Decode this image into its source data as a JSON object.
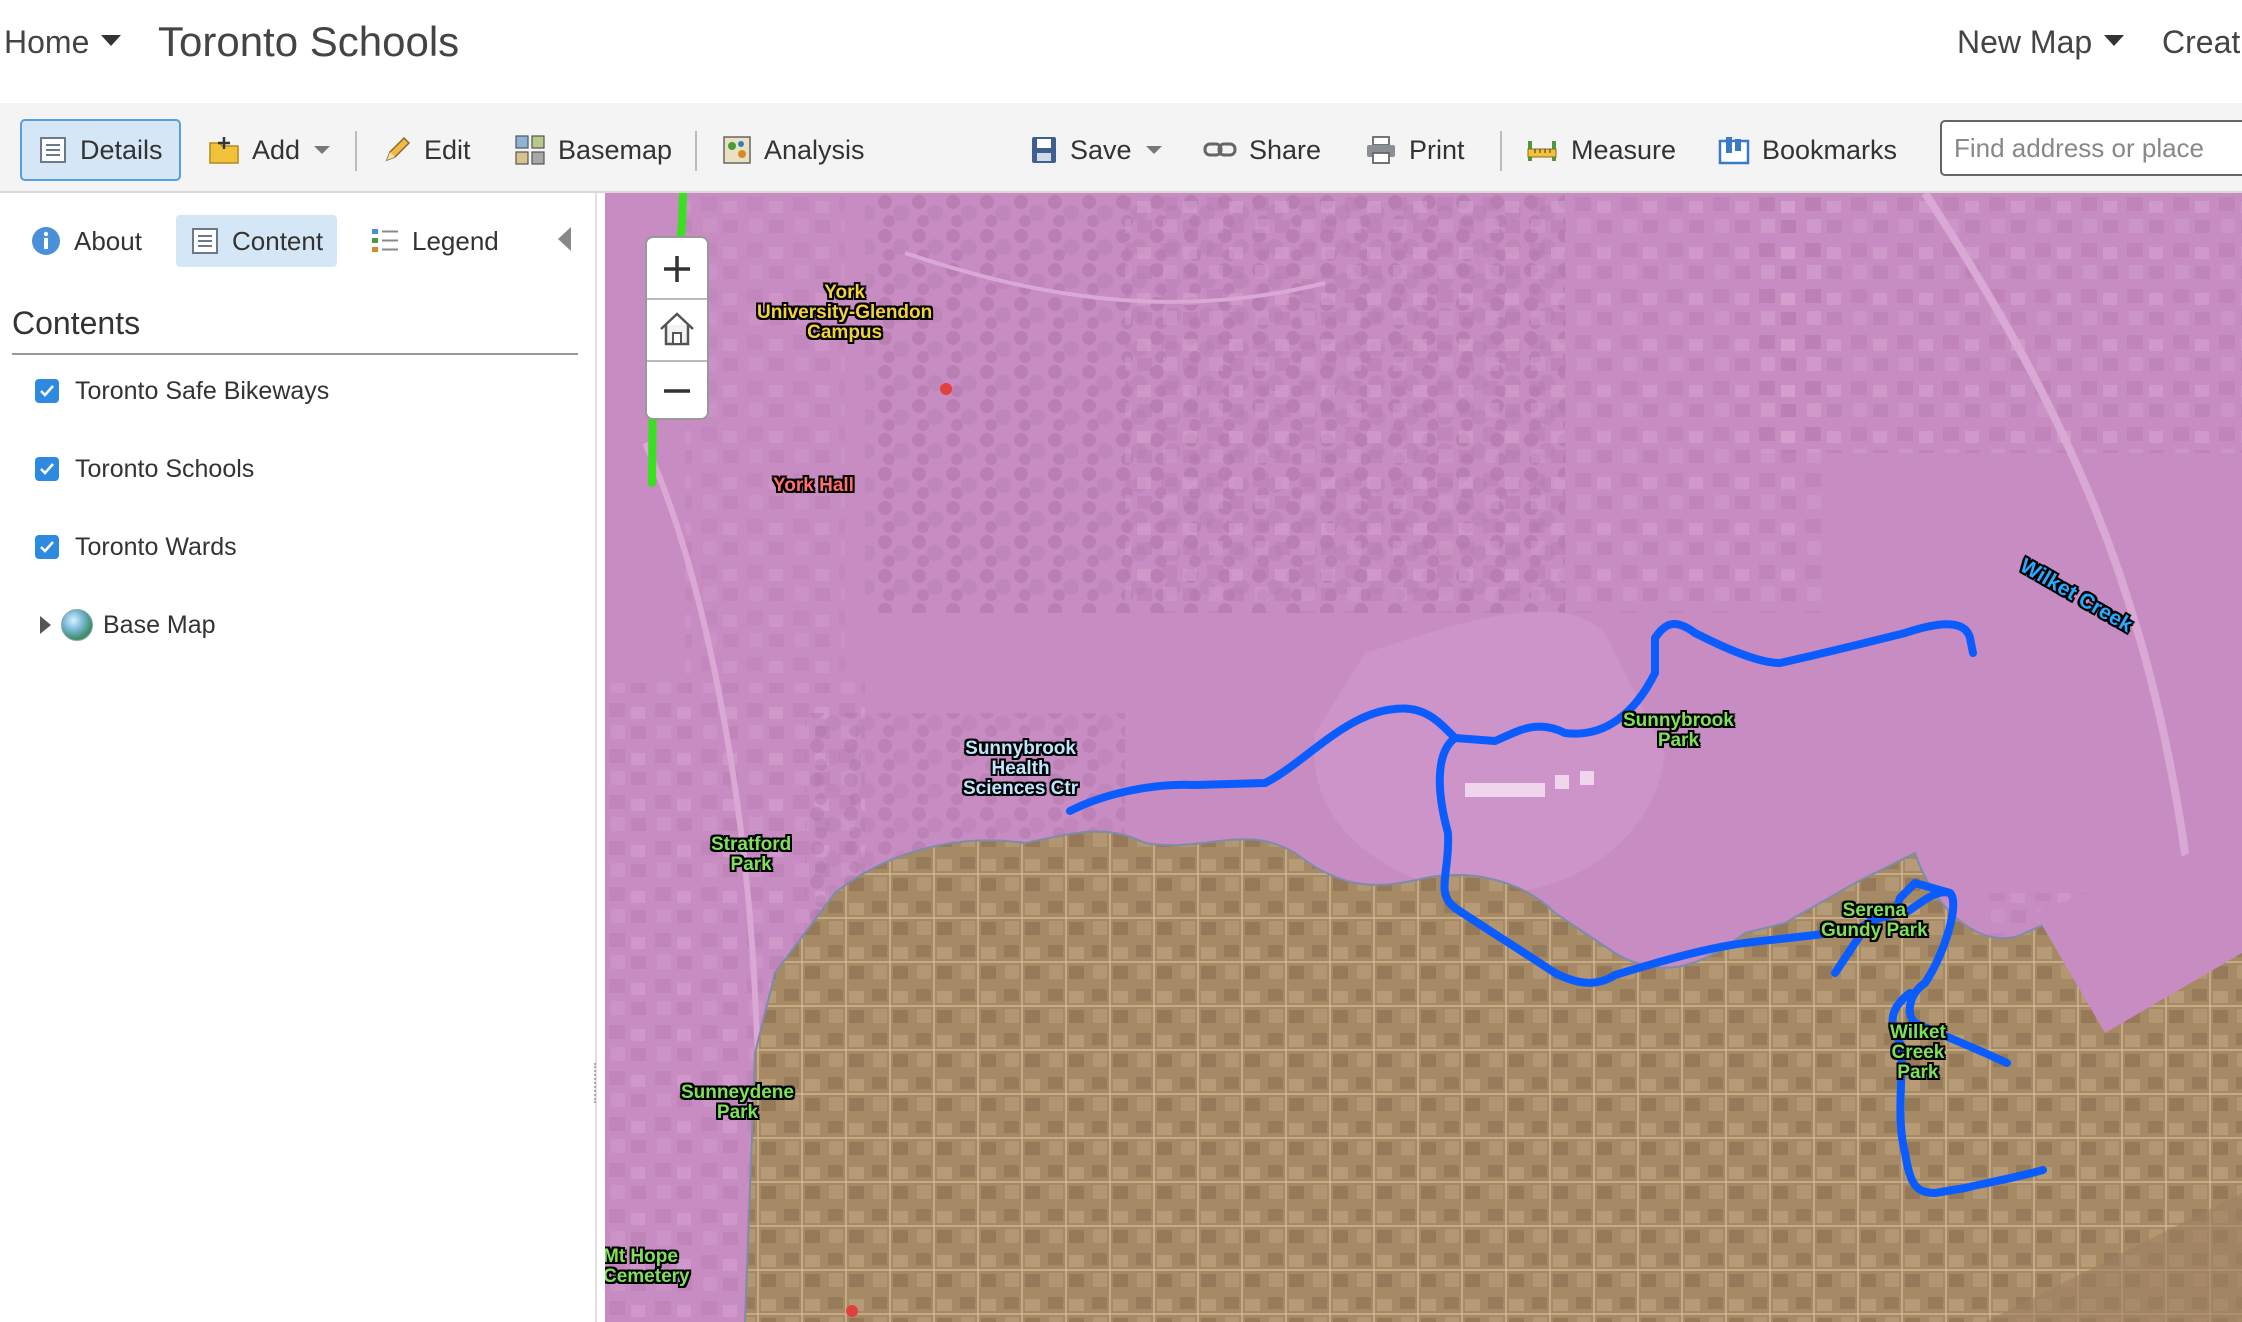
{
  "topbar": {
    "home_label": "Home",
    "title": "Toronto Schools",
    "new_map_label": "New Map",
    "create_label": "Creat"
  },
  "toolbar": {
    "details_label": "Details",
    "add_label": "Add",
    "edit_label": "Edit",
    "basemap_label": "Basemap",
    "analysis_label": "Analysis",
    "save_label": "Save",
    "share_label": "Share",
    "print_label": "Print",
    "measure_label": "Measure",
    "bookmarks_label": "Bookmarks",
    "search_placeholder": "Find address or place"
  },
  "panel": {
    "tabs": [
      {
        "label": "About",
        "icon": "info-icon"
      },
      {
        "label": "Content",
        "icon": "content-icon",
        "active": true
      },
      {
        "label": "Legend",
        "icon": "legend-icon"
      }
    ],
    "contents_heading": "Contents",
    "layers": [
      {
        "label": "Toronto Safe Bikeways",
        "checked": true
      },
      {
        "label": "Toronto Schools",
        "checked": true
      },
      {
        "label": "Toronto Wards",
        "checked": true
      },
      {
        "label": "Base Map",
        "expandable": true,
        "icon": "globe-icon"
      }
    ]
  },
  "map": {
    "colors": {
      "ward_pink": "#c78cc1",
      "ward_tan": "#a68a66",
      "bikeway_blue": "#0a5cff",
      "bikeway_green": "#39e020",
      "school_red": "#e0413f"
    },
    "labels": {
      "york_glendon": [
        "York",
        "University-Glendon",
        "Campus"
      ],
      "york_hall": "York Hall",
      "sunnybrook_hsc": [
        "Sunnybrook",
        "Health",
        "Sciences Ctr"
      ],
      "sunnybrook_park": [
        "Sunnybrook",
        "Park"
      ],
      "stratford_park": [
        "Stratford",
        "Park"
      ],
      "sunneydene_park": [
        "Sunneydene",
        "Park"
      ],
      "mt_hope": [
        "Mt Hope",
        "Cemetery"
      ],
      "serena_gundy": [
        "Serena",
        "Gundy Park"
      ],
      "wilket_creek_park": [
        "Wilket",
        "Creek",
        "Park"
      ],
      "wilket_creek": "Wilket Creek"
    }
  }
}
